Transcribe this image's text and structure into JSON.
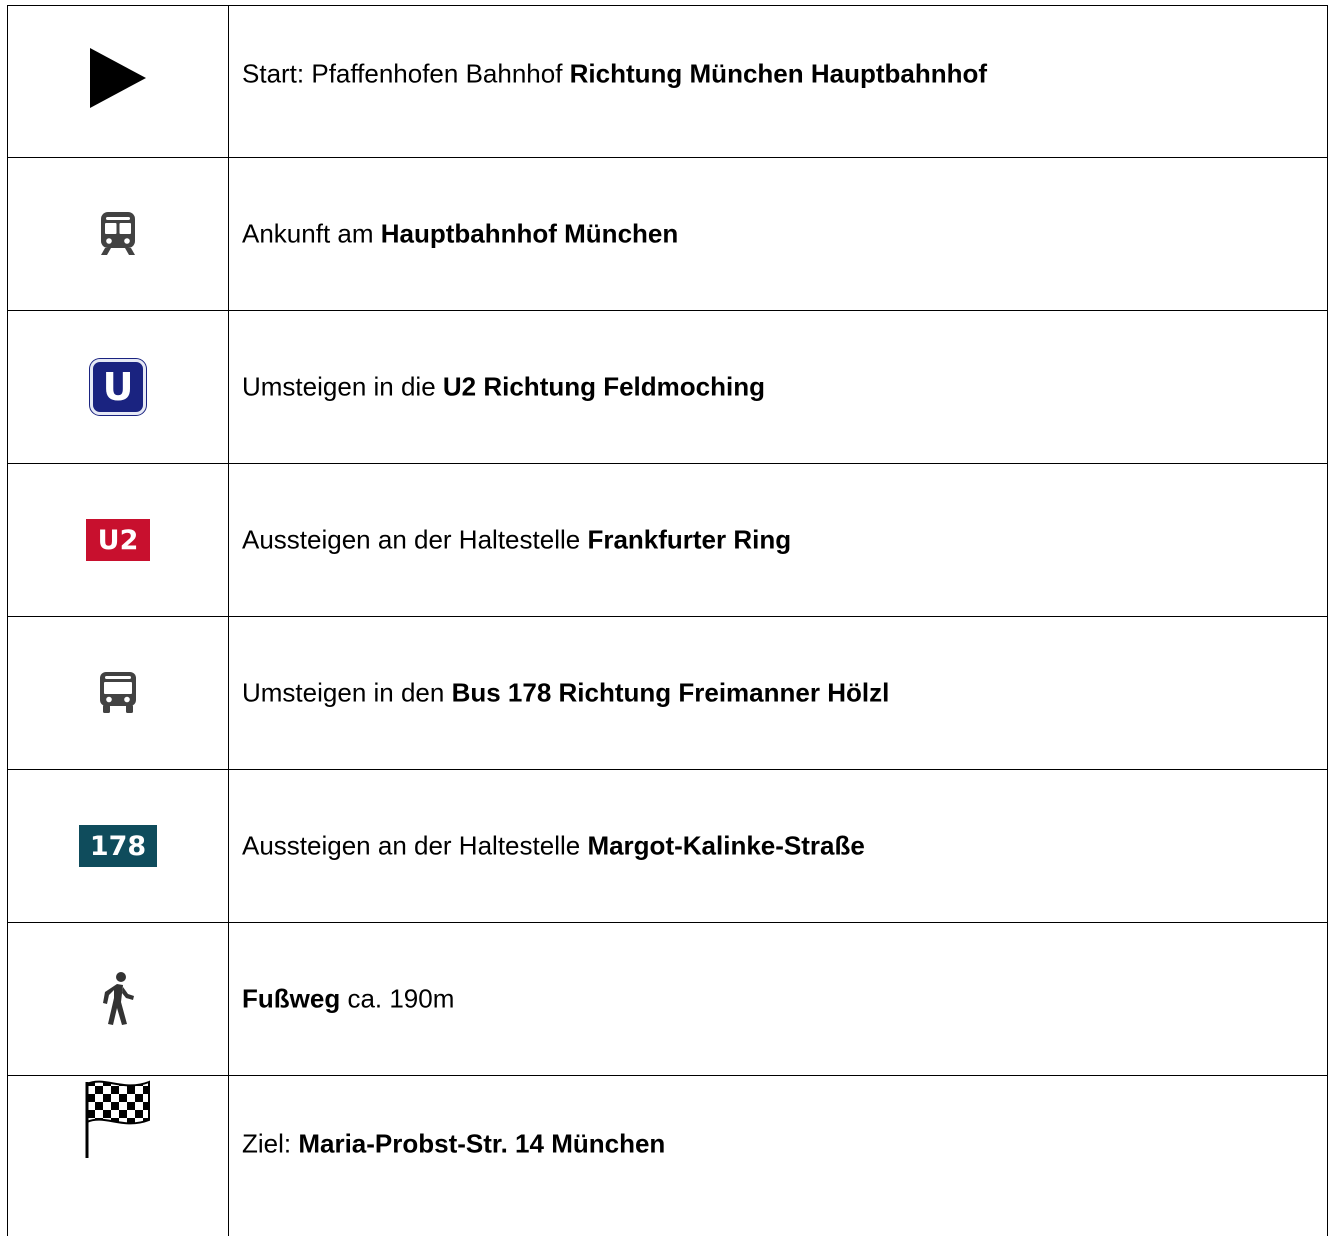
{
  "rows": [
    {
      "icon": "play-triangle-icon",
      "text_plain": "Start: Pfaffenhofen Bahnhof ",
      "text_bold": "Richtung München Hauptbahnhof"
    },
    {
      "icon": "train-icon",
      "text_plain": "Ankunft am ",
      "text_bold": "Hauptbahnhof München"
    },
    {
      "icon": "ubahn-icon",
      "icon_label": "U",
      "text_plain": "Umsteigen in die ",
      "text_bold": "U2 Richtung Feldmoching"
    },
    {
      "icon": "line-badge-icon",
      "icon_label": "U2",
      "text_plain": "Aussteigen an der Haltestelle ",
      "text_bold": "Frankfurter Ring"
    },
    {
      "icon": "bus-icon",
      "text_plain": "Umsteigen in den ",
      "text_bold": "Bus 178 Richtung Freimanner Hölzl"
    },
    {
      "icon": "line-badge-icon",
      "icon_label": "178",
      "text_plain": "Aussteigen an der Haltestelle ",
      "text_bold": "Margot-Kalinke-Straße"
    },
    {
      "icon": "walking-person-icon",
      "text_bold": "Fußweg",
      "text_plain": " ca. 190m"
    },
    {
      "icon": "checkered-flag-icon",
      "text_plain": "Ziel: ",
      "text_bold": "Maria-Probst-Str. 14 München"
    }
  ],
  "colors": {
    "ubahn_blue": "#1a2380",
    "u2_red": "#c8102e",
    "bus_178_teal": "#0f4c5c",
    "icon_gray": "#424242"
  }
}
